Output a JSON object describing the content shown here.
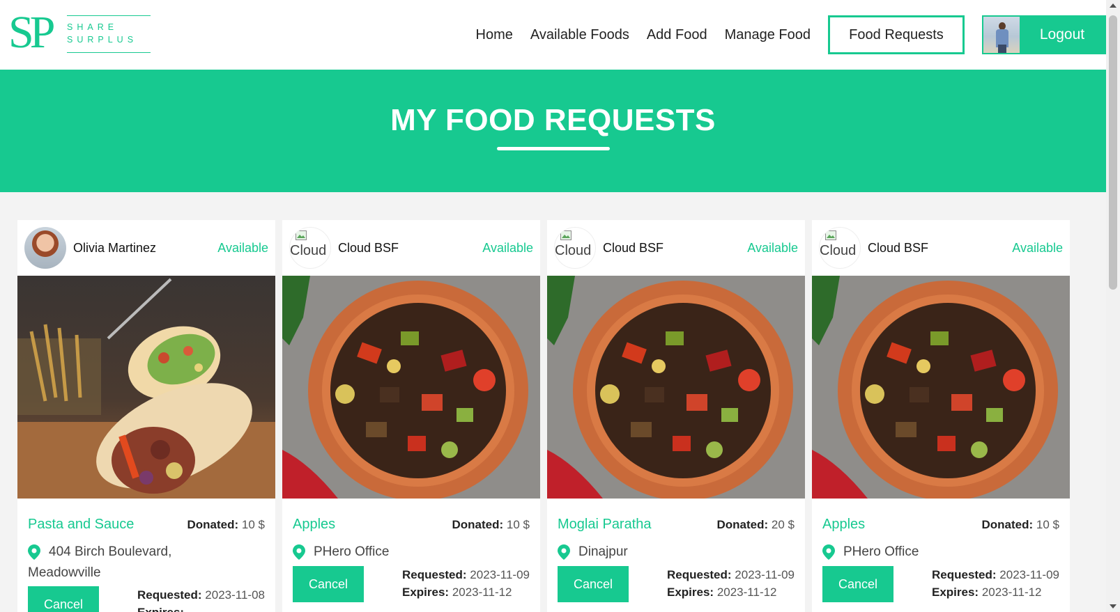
{
  "brand": {
    "initials": "SP",
    "line1": "SHARE",
    "line2": "SURPLUS",
    "color": "#17c990"
  },
  "nav": {
    "links": [
      "Home",
      "Available Foods",
      "Add Food",
      "Manage Food"
    ],
    "active_button": "Food Requests",
    "logout_button": "Logout"
  },
  "banner": {
    "title": "MY FOOD REQUESTS"
  },
  "labels": {
    "donated": "Donated:",
    "requested": "Requested:",
    "expires": "Expires:",
    "cancel": "Cancel",
    "broken_image_alt": "Cloud"
  },
  "cards": [
    {
      "donor": "Olivia Martinez",
      "status": "Available",
      "food": "Pasta and Sauce",
      "donated": "10 $",
      "location": "404 Birch Boulevard, Meadowville",
      "requested": "2023-11-08",
      "expires": ""
    },
    {
      "donor": "Cloud BSF",
      "status": "Available",
      "food": "Apples",
      "donated": "10 $",
      "location": "PHero Office",
      "requested": "2023-11-09",
      "expires": "2023-11-12"
    },
    {
      "donor": "Cloud BSF",
      "status": "Available",
      "food": "Moglai Paratha",
      "donated": "20 $",
      "location": "Dinajpur",
      "requested": "2023-11-09",
      "expires": "2023-11-12"
    },
    {
      "donor": "Cloud BSF",
      "status": "Available",
      "food": "Apples",
      "donated": "10 $",
      "location": "PHero Office",
      "requested": "2023-11-09",
      "expires": "2023-11-12"
    }
  ]
}
